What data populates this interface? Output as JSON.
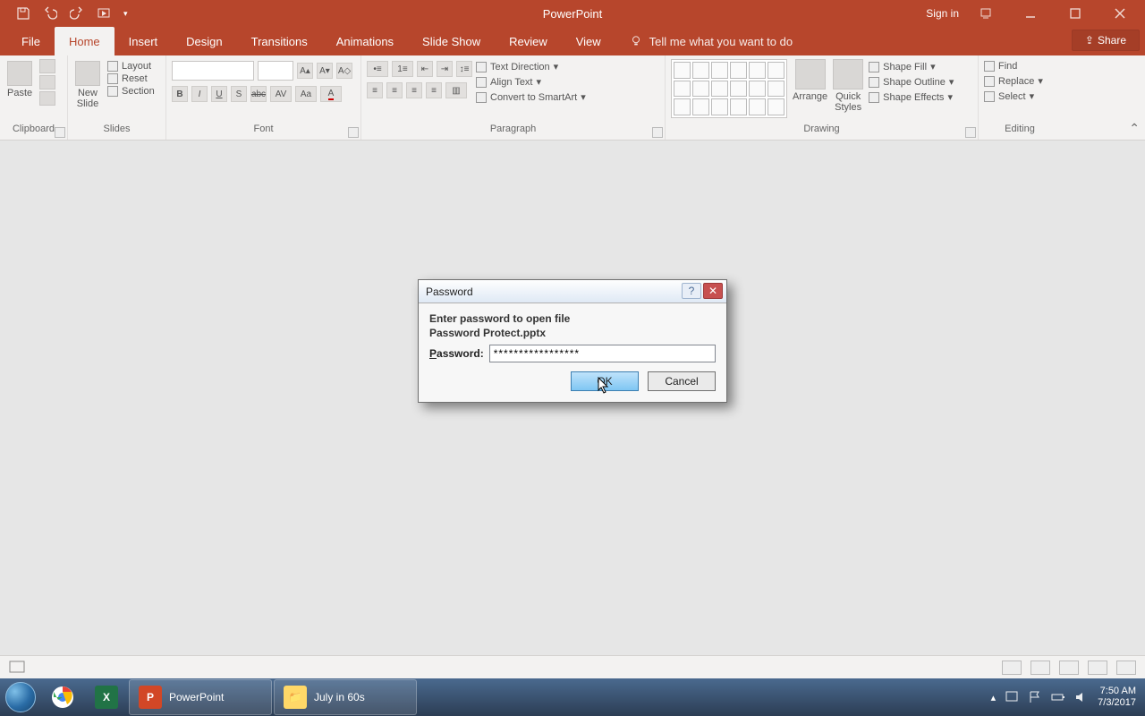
{
  "titlebar": {
    "app_title": "PowerPoint",
    "sign_in": "Sign in"
  },
  "tabs": {
    "file": "File",
    "home": "Home",
    "insert": "Insert",
    "design": "Design",
    "transitions": "Transitions",
    "animations": "Animations",
    "slideshow": "Slide Show",
    "review": "Review",
    "view": "View",
    "tellme": "Tell me what you want to do",
    "share": "Share"
  },
  "ribbon": {
    "clipboard": {
      "paste": "Paste",
      "label": "Clipboard"
    },
    "slides": {
      "newslide": "New\nSlide",
      "layout": "Layout",
      "reset": "Reset",
      "section": "Section",
      "label": "Slides"
    },
    "font": {
      "label": "Font"
    },
    "paragraph": {
      "text_direction": "Text Direction",
      "align_text": "Align Text",
      "convert_smartart": "Convert to SmartArt",
      "label": "Paragraph"
    },
    "drawing": {
      "arrange": "Arrange",
      "quick_styles": "Quick\nStyles",
      "shape_fill": "Shape Fill",
      "shape_outline": "Shape Outline",
      "shape_effects": "Shape Effects",
      "label": "Drawing"
    },
    "editing": {
      "find": "Find",
      "replace": "Replace",
      "select": "Select",
      "label": "Editing"
    }
  },
  "dialog": {
    "title": "Password",
    "prompt": "Enter password to open file",
    "filename": "Password Protect.pptx",
    "password_label": "Password:",
    "password_value": "*****************",
    "ok": "OK",
    "cancel": "Cancel"
  },
  "taskbar": {
    "app1": "PowerPoint",
    "app2": "July in 60s",
    "time": "7:50 AM",
    "date": "7/3/2017"
  }
}
